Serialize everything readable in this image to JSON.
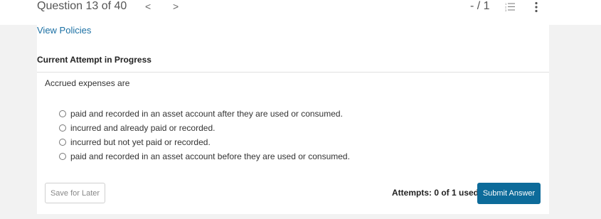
{
  "header": {
    "question_label": "Question 13 of 40",
    "prev_glyph": "<",
    "next_glyph": ">",
    "score": "- / 1"
  },
  "panel": {
    "view_policies": "View Policies",
    "attempt_heading": "Current Attempt in Progress",
    "question": "Accrued expenses are",
    "options": [
      "paid and recorded in an asset account after they are used or consumed.",
      "incurred and already paid or recorded.",
      "incurred but not yet paid or recorded.",
      "paid and recorded in an asset account before they are used or consumed."
    ],
    "save_label": "Save for Later",
    "attempts_text": "Attempts: 0 of 1 used",
    "submit_label": "Submit Answer"
  },
  "colors": {
    "link": "#1a6fa3",
    "primary_button": "#0d6b9a",
    "background": "#f2f2f2"
  },
  "icons": {
    "list": "numbered-list-icon",
    "more": "vertical-ellipsis-icon"
  }
}
